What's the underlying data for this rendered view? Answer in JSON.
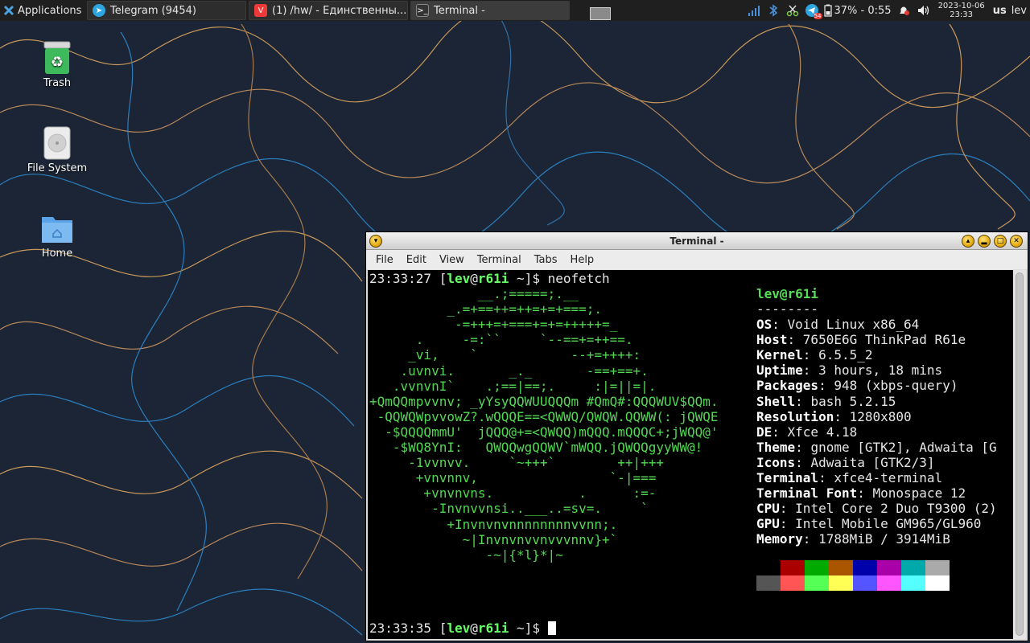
{
  "panel": {
    "apps_label": "Applications",
    "tasks": [
      {
        "label": "Telegram (9454)",
        "icon": "telegram-icon"
      },
      {
        "label": "(1) /hw/ - Единственны...",
        "icon": "vivaldi-icon"
      },
      {
        "label": "Terminal -",
        "icon": "terminal-icon",
        "active": true
      }
    ],
    "battery_text": "37% - 0:55",
    "clock_date": "2023-10-06",
    "clock_time": "23:33",
    "keyboard_layout": "us",
    "user": "lev",
    "telegram_badge": "54"
  },
  "desktop": {
    "icons": [
      {
        "label": "Trash",
        "icon": "trash-icon"
      },
      {
        "label": "File System",
        "icon": "drive-icon"
      },
      {
        "label": "Home",
        "icon": "home-folder-icon"
      }
    ]
  },
  "terminal": {
    "title": "Terminal -",
    "menu": [
      "File",
      "Edit",
      "View",
      "Terminal",
      "Tabs",
      "Help"
    ],
    "prompt1": {
      "time": "23:33:27",
      "user": "lev",
      "host": "r61i",
      "cwd": "~",
      "command": "neofetch"
    },
    "prompt2": {
      "time": "23:33:35",
      "user": "lev",
      "host": "r61i",
      "cwd": "~"
    },
    "art": [
      "              __.;=====;.__",
      "          _.=+==++=++=+=+===;.",
      "           -=+++=+===+=+=+++++=_",
      "      .     -=:``     `--==+=++==.",
      "     _vi,    `            --+=++++:",
      "    .uvnvi.       _._       -==+==+.",
      "   .vvnvnI`    .;==|==;.     :|=||=|.",
      "+QmQQmpvvnv; _yYsyQQWUUQQQm #QmQ#:QQQWUV$QQm.",
      " -QQWQWpvvowZ?.wQQQE==<QWWQ/QWQW.QQWW(: jQWQE",
      "  -$QQQQmmU'  jQQQ@+=<QWQQ)mQQQ.mQQQC+;jWQQ@'",
      "   -$WQ8YnI:   QWQQwgQQWV`mWQQ.jQWQQgyyWW@!",
      "     -1vvnvv.     `~+++`        ++|+++",
      "      +vnvnnv,                 `-|===",
      "       +vnvnvns.           .      :=-",
      "        -Invnvvnsi..___..=sv=.     `",
      "          +Invnvnvnnnnnnnnvvnn;.",
      "            ~|Invnvnvvnvvvnnv}+`",
      "               -~|{*l}*|~"
    ],
    "info": {
      "userhost": "lev@r61i",
      "separator": "--------",
      "rows": [
        {
          "key": "OS",
          "value": "Void Linux x86_64"
        },
        {
          "key": "Host",
          "value": "7650E6G ThinkPad R61e"
        },
        {
          "key": "Kernel",
          "value": "6.5.5_2"
        },
        {
          "key": "Uptime",
          "value": "3 hours, 18 mins"
        },
        {
          "key": "Packages",
          "value": "948 (xbps-query)"
        },
        {
          "key": "Shell",
          "value": "bash 5.2.15"
        },
        {
          "key": "Resolution",
          "value": "1280x800"
        },
        {
          "key": "DE",
          "value": "Xfce 4.18"
        },
        {
          "key": "Theme",
          "value": "gnome [GTK2], Adwaita [G"
        },
        {
          "key": "Icons",
          "value": "Adwaita [GTK2/3]"
        },
        {
          "key": "Terminal",
          "value": "xfce4-terminal"
        },
        {
          "key": "Terminal Font",
          "value": "Monospace 12"
        },
        {
          "key": "CPU",
          "value": "Intel Core 2 Duo T9300 (2)"
        },
        {
          "key": "GPU",
          "value": "Intel Mobile GM965/GL960"
        },
        {
          "key": "Memory",
          "value": "1788MiB / 3914MiB"
        }
      ],
      "palette": [
        "#000000",
        "#aa0000",
        "#00aa00",
        "#aa5500",
        "#0000aa",
        "#aa00aa",
        "#00aaaa",
        "#aaaaaa",
        "#555555",
        "#ff5555",
        "#55ff55",
        "#ffff55",
        "#5555ff",
        "#ff55ff",
        "#55ffff",
        "#ffffff"
      ]
    }
  }
}
